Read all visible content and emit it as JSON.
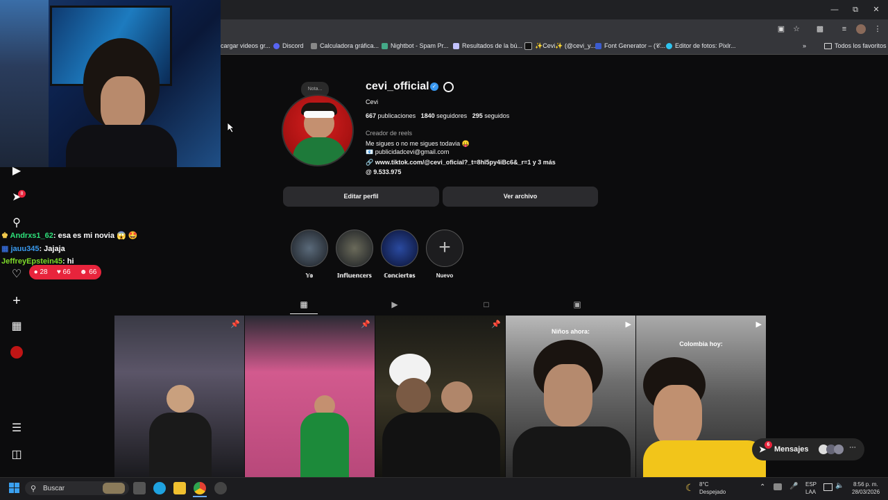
{
  "browser": {
    "bookmarks": [
      {
        "label": "cargar videos gr..."
      },
      {
        "label": "Discord"
      },
      {
        "label": "Calculadora gráfica..."
      },
      {
        "label": "Nightbot - Spam Pr..."
      },
      {
        "label": "Resultados de la bú..."
      },
      {
        "label": "✨Cevi✨ (@cevi_y..."
      },
      {
        "label": "Font Generator – (𝒞..."
      },
      {
        "label": "Editor de fotos: Pixlr..."
      }
    ],
    "all_favorites": "Todos los favoritos"
  },
  "chat": {
    "messages": [
      {
        "user": "Andrxs1_62",
        "text": ": esa es mi novia 😱 🤩",
        "user_color": "#2ee07a"
      },
      {
        "user": "jauu345",
        "text": ": Jajaja",
        "user_color": "#3a9bf0"
      },
      {
        "user": "JeffreyEpstein45",
        "text": ": hi",
        "user_color": "#7fdc2a"
      }
    ],
    "comments": "28",
    "likes": "66",
    "viewers": "66",
    "notif_badge": "8"
  },
  "profile": {
    "note": "Nota...",
    "username": "cevi_official",
    "display_name": "Cevi",
    "posts_count": "667",
    "posts_label": "publicaciones",
    "followers_count": "1840",
    "followers_label": "seguidores",
    "following_count": "295",
    "following_label": "seguidos",
    "category": "Creador de reels",
    "bio_line1": "Me sigues o no me sigues todavia 😛",
    "bio_email": "📧 publicidadcevi@gmail.com",
    "bio_link": "www.tiktok.com/@cevi_oficial?_t=8hI5py4iBc6&_r=1 y 3 más",
    "threads": "9.533.975",
    "edit_button": "Editar perfil",
    "archive_button": "Ver archivo"
  },
  "highlights": [
    {
      "label": "𝕐𝕠"
    },
    {
      "label": "𝕀𝕟𝕗𝕝𝕦𝕖𝕟𝕔𝕖𝕣𝕤"
    },
    {
      "label": "ℂ𝕠𝕟𝕔𝕚𝕖𝕣𝕥𝕠𝕤"
    },
    {
      "label": "Nuevo"
    }
  ],
  "posts": [
    {
      "caption": ""
    },
    {
      "caption": ""
    },
    {
      "caption": ""
    },
    {
      "caption": "Niños ahora:"
    },
    {
      "caption": "Colombia hoy:"
    }
  ],
  "messages_bar": {
    "label": "Mensajes",
    "badge": "6"
  },
  "taskbar": {
    "search": "Buscar",
    "weather_temp": "8°C",
    "weather_desc": "Despejado",
    "lang1": "ESP",
    "lang2": "LAA",
    "time": "8:56 p. m.",
    "date": "28/03/2026"
  },
  "colors": {
    "verified": "#3897f0",
    "live_red": "#e8243c"
  }
}
